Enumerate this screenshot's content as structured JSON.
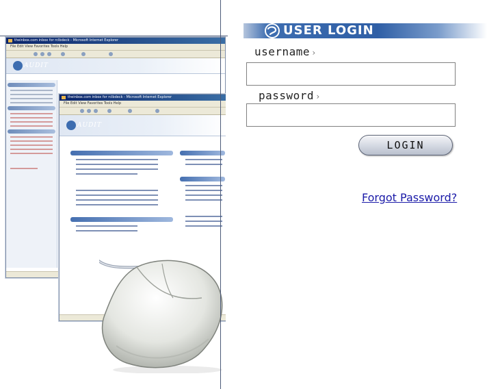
{
  "login": {
    "banner_title": "USER LOGIN",
    "banner_icon": "logo-swirl-icon",
    "username_label": "username",
    "password_label": "password",
    "label_arrow": "›",
    "username_value": "",
    "password_value": "",
    "login_button": "LOGIN",
    "forgot_link": "Forgot Password?"
  },
  "illustration": {
    "window1": {
      "title": "theinbox.com inbox for rclbdeck - Microsoft Internet Explorer",
      "menu": "File  Edit  View  Favorites  Tools  Help",
      "logo": "AUDIT"
    },
    "window2": {
      "title": "theinbox.com inbox for rclbdeck - Microsoft Internet Explorer",
      "menu": "File  Edit  View  Favorites  Tools  Help",
      "logo": "AUDIT"
    },
    "mouse_icon": "computer-mouse-icon"
  },
  "colors": {
    "banner_blue": "#2f5fa6",
    "link": "#1a1aa8",
    "divider": "#4c5a78"
  }
}
